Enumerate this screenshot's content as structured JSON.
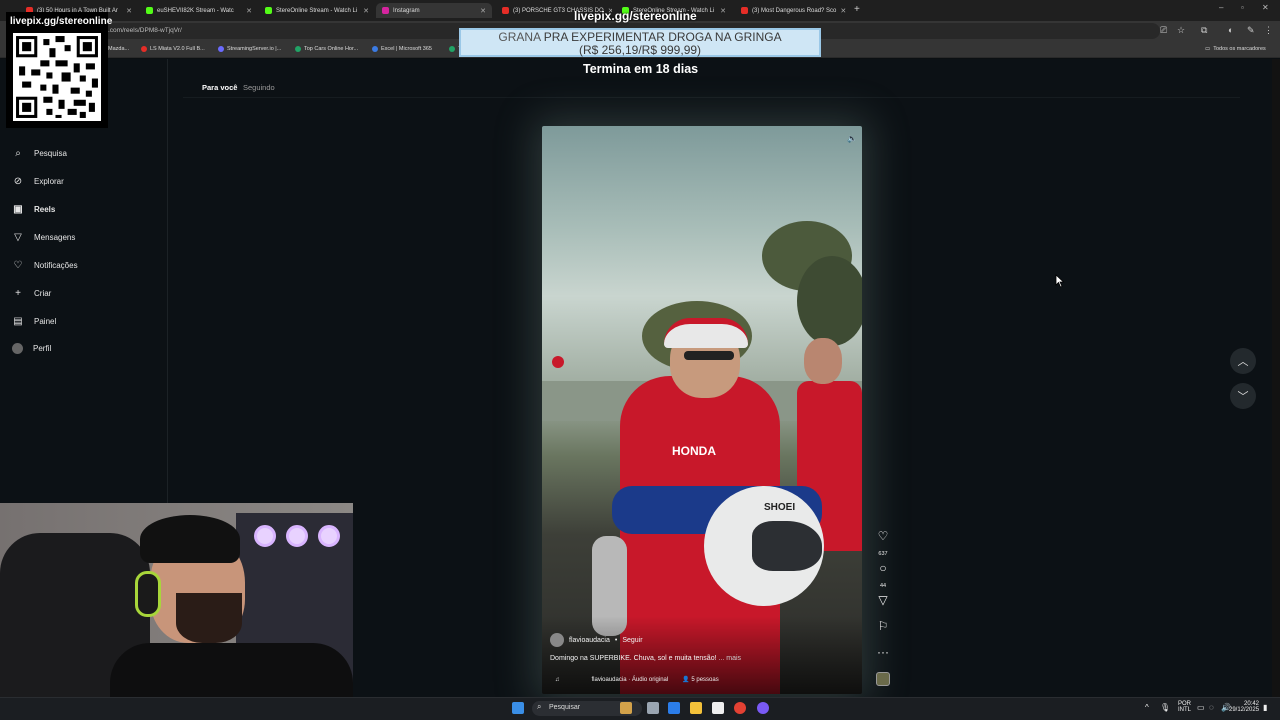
{
  "tabs": [
    {
      "label": "(3) 50 Hours in A Town Built Ar",
      "color": "#e52d27"
    },
    {
      "label": "euSHEVII82K Stream - Watc",
      "color": "#53fc18"
    },
    {
      "label": "StereOnline Stream - Watch Li",
      "color": "#53fc18"
    },
    {
      "label": "Instagram",
      "color": "#d6249f"
    },
    {
      "label": "(3) PORSCHE GT3 CHASSIS DO",
      "color": "#e52d27"
    },
    {
      "label": "StereOnline Stream - Watch Li",
      "color": "#53fc18"
    },
    {
      "label": "(3) Most Dangerous Road? Sco",
      "color": "#e52d27"
    }
  ],
  "address": {
    "url": ".com/reels/DPM8-wTjqVr/"
  },
  "bookmarks": [
    {
      "label": "Mazda...",
      "color": "#888888"
    },
    {
      "label": "LS Miata V2.0 Full B...",
      "color": "#e52d27"
    },
    {
      "label": "StreamingServer.io |...",
      "color": "#6b6bff"
    },
    {
      "label": "Top Cars Online Hor...",
      "color": "#21a366"
    },
    {
      "label": "Excel | Microsoft 365",
      "color": "#3b7be3"
    },
    {
      "label": "T",
      "color": "#21a366"
    }
  ],
  "bookmarks_right": "Todos os marcadores",
  "sidebar": {
    "items": [
      {
        "label": "Pesquisa",
        "icon": "search-icon"
      },
      {
        "label": "Explorar",
        "icon": "compass-icon"
      },
      {
        "label": "Reels",
        "icon": "reels-icon"
      },
      {
        "label": "Mensagens",
        "icon": "send-icon"
      },
      {
        "label": "Notificações",
        "icon": "heart-icon"
      },
      {
        "label": "Criar",
        "icon": "plus-icon"
      },
      {
        "label": "Painel",
        "icon": "dashboard-icon"
      },
      {
        "label": "Perfil",
        "icon": "avatar-icon"
      }
    ]
  },
  "feed_tabs": {
    "for_you": "Para você",
    "following": "Seguindo"
  },
  "overlay": {
    "qr_label": "livepix.gg/stereonline",
    "top_label": "livepix.gg/stereonline",
    "donation_line1_highlight": "GRANA",
    "donation_line1": " PRA EXPERIMENTAR DROGA NA GRINGA",
    "donation_line2": "(R$ 256,19/R$ 999,99)",
    "ends_in": "Termina em 18 dias"
  },
  "reel": {
    "username": "flavioaudacia",
    "follow": "Seguir",
    "caption": "Domingo na SUPERBIKE. Chuva, sol e muita tensão! ",
    "more": "... mais",
    "audio": "flavioaudacia · Áudio original",
    "people": "5 pessoas",
    "likes": "637",
    "comments": "44",
    "helmet_text": "SHOEI",
    "suit_text": "HONDA"
  },
  "taskbar": {
    "search": "Pesquisar",
    "lang_top": "POR",
    "lang_bottom": "INTL",
    "time": "20:42",
    "date": "29/12/2025"
  }
}
